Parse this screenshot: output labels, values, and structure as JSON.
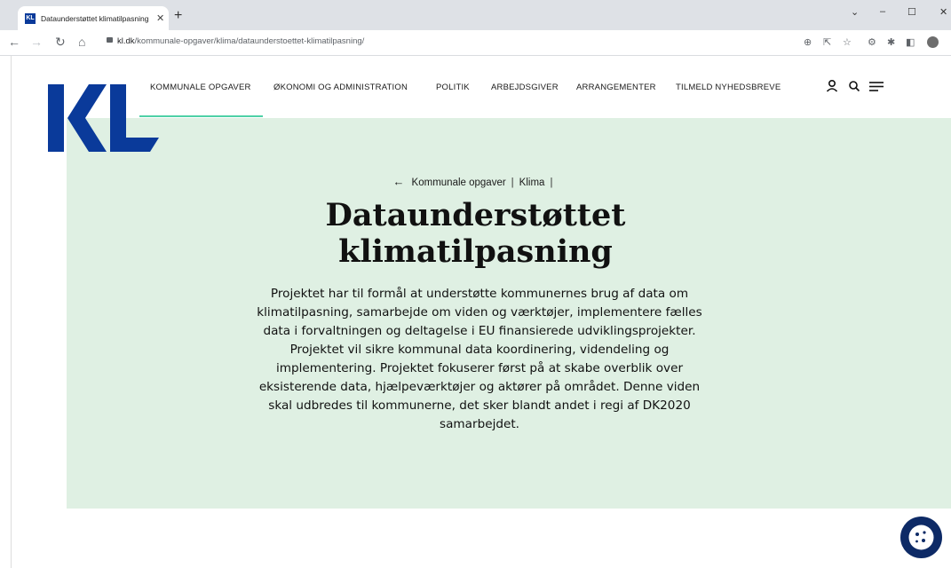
{
  "browser": {
    "tab_title": "Dataunderstøttet klimatilpasning",
    "tab_favicon": "KL",
    "url_host": "kl.dk",
    "url_path": "/kommunale-opgaver/klima/dataunderstoettet-klimatilpasning/"
  },
  "site": {
    "logo_text": "KL",
    "brand_color": "#0a3a9a",
    "accent_color": "#4fd1a6",
    "hero_color": "#dff0e3",
    "nav": [
      "KOMMUNALE OPGAVER",
      "ØKONOMI OG ADMINISTRATION",
      "POLITIK",
      "ARBEJDSGIVER",
      "ARRANGEMENTER",
      "TILMELD NYHEDSBREVE"
    ],
    "icons": [
      "user-icon",
      "search-icon",
      "menu-icon"
    ]
  },
  "breadcrumb": {
    "items": [
      "Kommunale opgaver",
      "Klima"
    ]
  },
  "page": {
    "title_line1": "Dataunderstøttet",
    "title_line2": "klimatilpasning",
    "lead": "Projektet har til formål at understøtte kommunernes brug af data om klimatilpasning, samarbejde om viden og værktøjer, implementere fælles data i forvaltningen og deltagelse i EU finansierede udviklingsprojekter. Projektet vil sikre kommunal data koordinering, videndeling og implementering. Projektet fokuserer først på at skabe overblik over eksisterende data, hjælpeværktøjer og aktører på området. Denne viden skal udbredes til kommunerne, det sker blandt andet i regi af DK2020 samarbejdet."
  }
}
